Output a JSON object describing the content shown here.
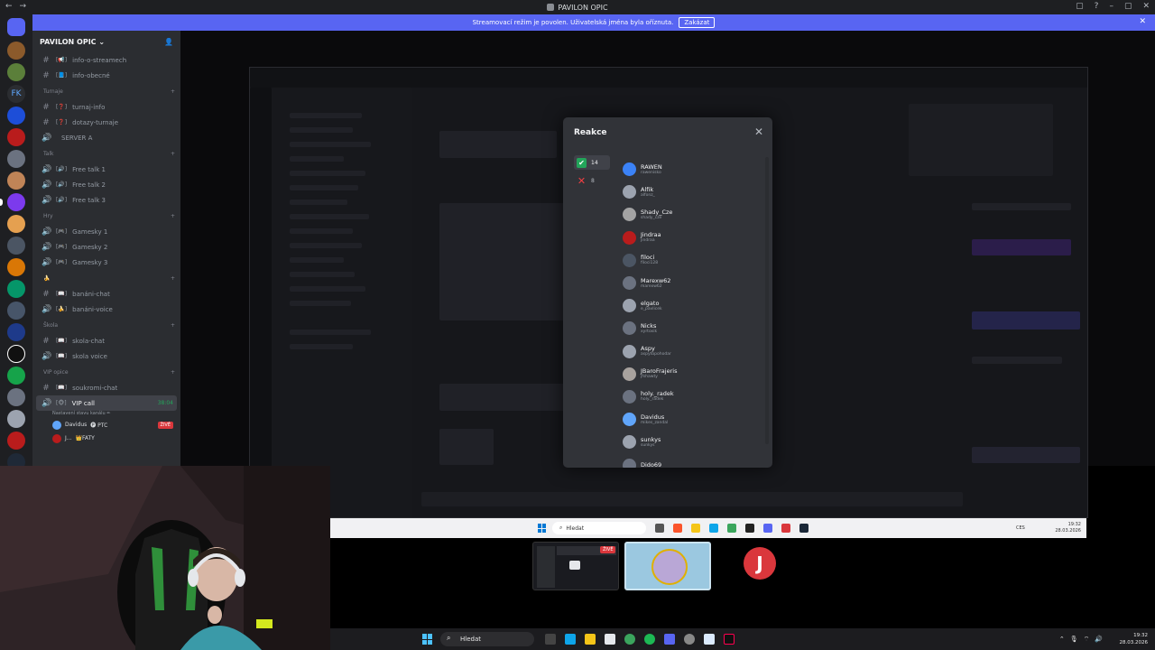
{
  "window": {
    "title": "PAVILON OPIC",
    "nav_back": "←",
    "nav_forward": "→"
  },
  "banner": {
    "text": "Streamovací režim je povolen. Uživatelská jména byla oříznuta.",
    "button": "Zakázat",
    "close": "✕"
  },
  "server": {
    "name": "PAVILON OPIC",
    "chevron": "⌄"
  },
  "channels": [
    {
      "kind": "text",
      "emoji": "[📢]",
      "name": "info-o-streamech"
    },
    {
      "kind": "text",
      "emoji": "[📘]",
      "name": "info-obecné"
    },
    {
      "kind": "category",
      "name": "Turnaje"
    },
    {
      "kind": "text",
      "emoji": "[❓]",
      "name": "turnaj-info"
    },
    {
      "kind": "text",
      "emoji": "[❓]",
      "name": "dotazy-turnaje"
    },
    {
      "kind": "voice",
      "emoji": "",
      "name": "SERVER A"
    },
    {
      "kind": "category",
      "name": "Talk"
    },
    {
      "kind": "voice",
      "emoji": "[🔊]",
      "name": "Free talk 1"
    },
    {
      "kind": "voice",
      "emoji": "[🔊]",
      "name": "Free talk 2"
    },
    {
      "kind": "voice",
      "emoji": "[🔊]",
      "name": "Free talk 3"
    },
    {
      "kind": "category",
      "name": "Hry"
    },
    {
      "kind": "voice",
      "emoji": "[🎮]",
      "name": "Gamesky 1"
    },
    {
      "kind": "voice",
      "emoji": "[🎮]",
      "name": "Gamesky 2"
    },
    {
      "kind": "voice",
      "emoji": "[🎮]",
      "name": "Gamesky 3"
    },
    {
      "kind": "category",
      "name": "🍌"
    },
    {
      "kind": "text",
      "emoji": "[📖]",
      "name": "banáni-chat"
    },
    {
      "kind": "voice",
      "emoji": "[🍌]",
      "name": "banáni-voice"
    },
    {
      "kind": "category",
      "name": "Škola"
    },
    {
      "kind": "text",
      "emoji": "[📖]",
      "name": "skola-chat"
    },
    {
      "kind": "voice",
      "emoji": "[📖]",
      "name": "skola voice"
    },
    {
      "kind": "category",
      "name": "VIP opice"
    },
    {
      "kind": "text",
      "emoji": "[📖]",
      "name": "soukromi-chat"
    }
  ],
  "active_voice": {
    "emoji": "[🐵]",
    "name": "VIP call",
    "timer": "38:04",
    "status": "Nastavení stavu kanálu ✏",
    "users": [
      {
        "name": "Davidus",
        "tag": "🅟 PTC",
        "live": "ŽIVĚ"
      },
      {
        "name": "J...",
        "tag": "👑FATY",
        "live": ""
      }
    ]
  },
  "modal": {
    "title": "Reakce",
    "close": "✕",
    "tabs": [
      {
        "emoji": "✔",
        "count": "14",
        "selected": true
      },
      {
        "emoji": "✕",
        "count": "8",
        "selected": false
      }
    ],
    "users": [
      {
        "name": "RAWEN",
        "handle": "rawenisko",
        "color": "#3b82f6"
      },
      {
        "name": "Alfik",
        "handle": "alfonz_",
        "color": "#9ca3af"
      },
      {
        "name": "Shady_Cze",
        "handle": "shady_cze",
        "color": "#a3a3a3"
      },
      {
        "name": "Jindraa",
        "handle": "jindraa",
        "color": "#b91c1c"
      },
      {
        "name": "filoci",
        "handle": "filoci128",
        "color": "#4b5563"
      },
      {
        "name": "Marexw62",
        "handle": "marexw62",
        "color": "#6b7280"
      },
      {
        "name": "elgato",
        "handle": "e_pavlicek",
        "color": "#9ca3af"
      },
      {
        "name": "Nicks",
        "handle": "xyrtoxik",
        "color": "#6b7280"
      },
      {
        "name": "Aspy",
        "handle": "aspytopohodar",
        "color": "#9ca3af"
      },
      {
        "name": "JBaroFrajeris",
        "handle": "jfshawty",
        "color": "#a8a29e"
      },
      {
        "name": "holy._radek",
        "handle": "holy._radek",
        "color": "#6b7280"
      },
      {
        "name": "Davidus",
        "handle": "mikes_zandal",
        "color": "#60a5fa"
      },
      {
        "name": "sunkys",
        "handle": "sunkys",
        "color": "#9ca3af"
      },
      {
        "name": "Dido69",
        "handle": "",
        "color": "#6b7280"
      }
    ]
  },
  "inner_taskbar": {
    "search": "Hledat",
    "time": "19:32",
    "date": "28.03.2026",
    "lang": "CES"
  },
  "thumbs": {
    "live": "ŽIVĚ"
  },
  "taskbar": {
    "search": "Hledat",
    "time": "19:32",
    "date": "28.03.2026"
  }
}
